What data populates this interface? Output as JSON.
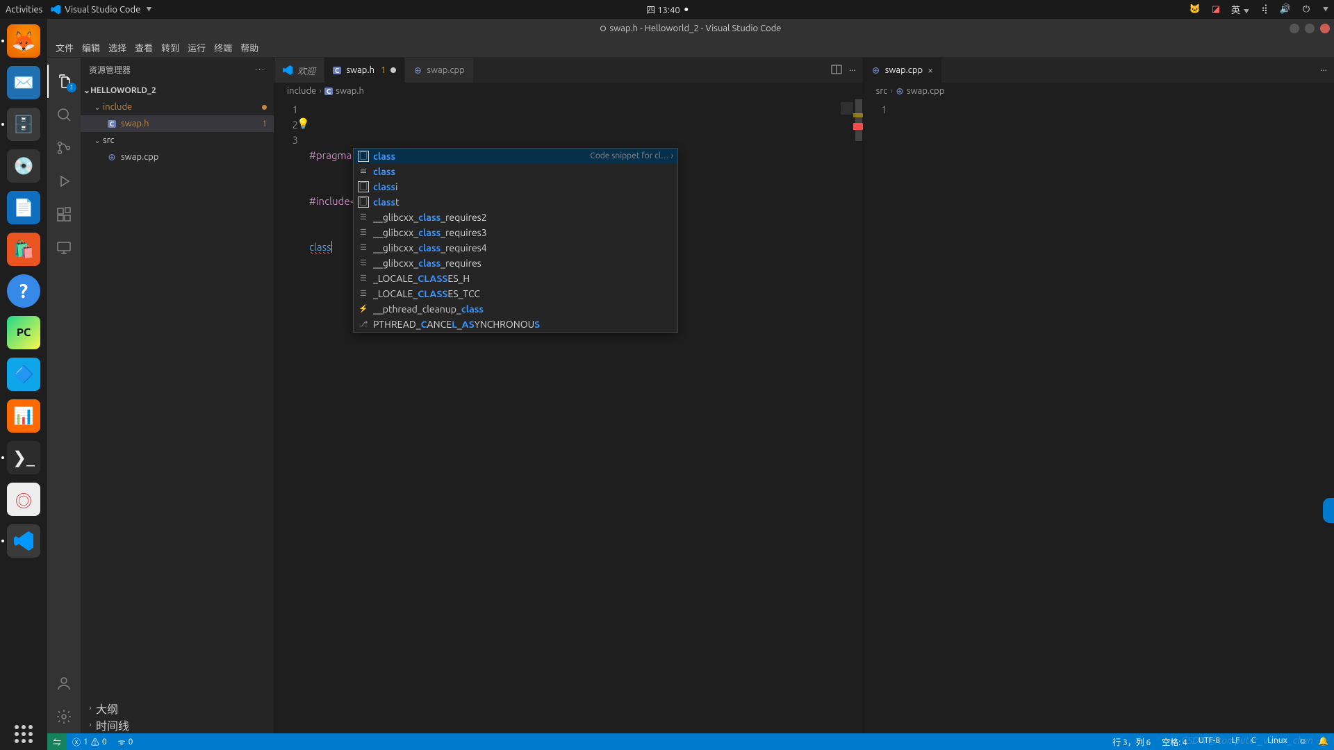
{
  "gnome": {
    "activities": "Activities",
    "app": "Visual Studio Code",
    "clock": "四 13:40",
    "lang": "英"
  },
  "window": {
    "title": "swap.h - Helloworld_2 - Visual Studio Code",
    "dirty_prefix": "●"
  },
  "menu": [
    "文件",
    "编辑",
    "选择",
    "查看",
    "转到",
    "运行",
    "终端",
    "帮助"
  ],
  "sidebar": {
    "title": "资源管理器",
    "root": "HELLOWORLD_2",
    "folders": [
      {
        "name": "include",
        "modified": true,
        "files": [
          {
            "name": "swap.h",
            "lang": "C",
            "problems": "1",
            "selected": true
          }
        ]
      },
      {
        "name": "src",
        "modified": false,
        "files": [
          {
            "name": "swap.cpp",
            "lang": "C⁺⁺"
          }
        ]
      }
    ],
    "panels": [
      "大纲",
      "时间线"
    ]
  },
  "tabs_left": [
    {
      "label": "欢迎",
      "icon": "vscode",
      "active": false
    },
    {
      "label": "swap.h",
      "icon": "C",
      "active": true,
      "problems": "1",
      "dirty": true
    },
    {
      "label": "swap.cpp",
      "icon": "C⁺⁺",
      "active": false,
      "closeable": true
    }
  ],
  "tabs_right": [
    {
      "label": "swap.cpp",
      "icon": "C⁺⁺",
      "active": true,
      "closeable": true
    }
  ],
  "breadcrumb_left": [
    "include",
    "swap.h"
  ],
  "breadcrumb_left_icon": "C",
  "breadcrumb_right": [
    "src",
    "swap.cpp"
  ],
  "breadcrumb_right_icon": "C⁺⁺",
  "code": {
    "lines": [
      {
        "n": "1",
        "html": "<span class='kw'>#pragma</span> <span class='mac'>once</span>"
      },
      {
        "n": "2",
        "html": "<span class='kw'>#include</span><span class='inc'>&lt;iostream&gt;</span>"
      },
      {
        "n": "3",
        "html": "<span class='class-tok squiggle-red'>class</span><span class='cursor'></span>"
      }
    ]
  },
  "right_code": {
    "lines": [
      {
        "n": "1",
        "html": ""
      }
    ]
  },
  "suggest": {
    "hint": "Code snippet for cl…",
    "items": [
      {
        "icon": "snip",
        "parts": [
          [
            "class",
            true
          ]
        ],
        "selected": true
      },
      {
        "icon": "txt",
        "parts": [
          [
            "class",
            true
          ]
        ]
      },
      {
        "icon": "snip",
        "parts": [
          [
            "class",
            true
          ],
          [
            "i",
            false
          ]
        ]
      },
      {
        "icon": "snip",
        "parts": [
          [
            "class",
            true
          ],
          [
            "t",
            false
          ]
        ]
      },
      {
        "icon": "kw-i",
        "parts": [
          [
            "__glibcxx_",
            false
          ],
          [
            "class",
            true
          ],
          [
            "_requires2",
            false
          ]
        ]
      },
      {
        "icon": "kw-i",
        "parts": [
          [
            "__glibcxx_",
            false
          ],
          [
            "class",
            true
          ],
          [
            "_requires3",
            false
          ]
        ]
      },
      {
        "icon": "kw-i",
        "parts": [
          [
            "__glibcxx_",
            false
          ],
          [
            "class",
            true
          ],
          [
            "_requires4",
            false
          ]
        ]
      },
      {
        "icon": "kw-i",
        "parts": [
          [
            "__glibcxx_",
            false
          ],
          [
            "class",
            true
          ],
          [
            "_requires",
            false
          ]
        ]
      },
      {
        "icon": "kw-i",
        "parts": [
          [
            "_LOCALE_",
            false
          ],
          [
            "CLASS",
            true
          ],
          [
            "ES_H",
            false
          ]
        ]
      },
      {
        "icon": "kw-i",
        "parts": [
          [
            "_LOCALE_",
            false
          ],
          [
            "CLASS",
            true
          ],
          [
            "ES_TCC",
            false
          ]
        ]
      },
      {
        "icon": "evt",
        "parts": [
          [
            "__pthread_cleanup_",
            false
          ],
          [
            "class",
            true
          ]
        ]
      },
      {
        "icon": "def",
        "parts": [
          [
            "PTHREAD_",
            false
          ],
          [
            "C",
            true
          ],
          [
            "ANCE",
            false
          ],
          [
            "L",
            true
          ],
          [
            "_",
            false
          ],
          [
            "AS",
            true
          ],
          [
            "YNCHRONOU",
            false
          ],
          [
            "S",
            true
          ]
        ]
      }
    ]
  },
  "status": {
    "errors": "1",
    "warnings": "0",
    "ports": "0",
    "line_col": "行 3，列 6",
    "spaces": "空格: 4",
    "encoding": "UTF-8",
    "eol": "LF",
    "lang": "C",
    "os": "Linux",
    "bell": "🔔"
  },
  "activity_badge": "1",
  "watermark": "CSDN @computer_vision_chen"
}
